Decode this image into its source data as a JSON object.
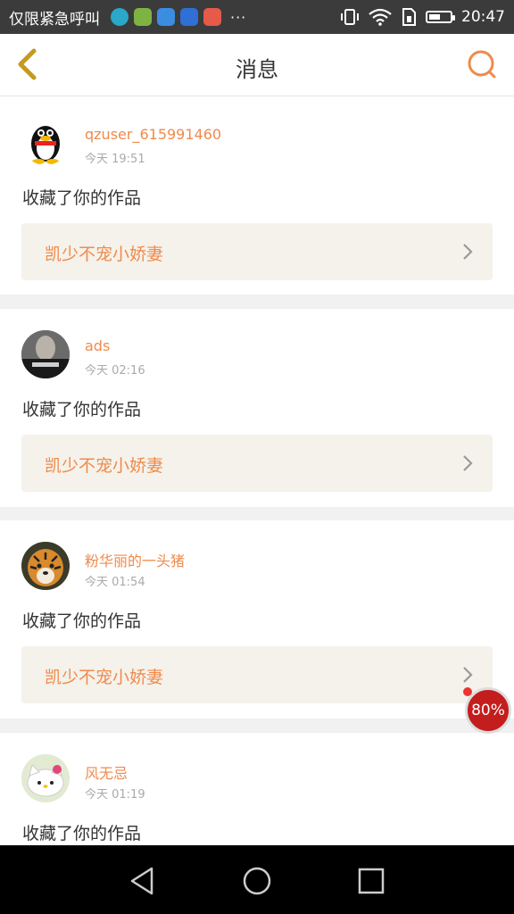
{
  "status_bar": {
    "carrier": "仅限紧急呼叫",
    "dots": "···",
    "time": "20:47",
    "battery_level": 0.55
  },
  "header": {
    "title": "消息"
  },
  "messages": [
    {
      "username": "qzuser_615991460",
      "time": "今天 19:51",
      "action": "收藏了你的作品",
      "work_title": "凯少不宠小娇妻"
    },
    {
      "username": "ads",
      "time": "今天 02:16",
      "action": "收藏了你的作品",
      "work_title": "凯少不宠小娇妻"
    },
    {
      "username": "粉华丽的一头猪",
      "time": "今天 01:54",
      "action": "收藏了你的作品",
      "work_title": "凯少不宠小娇妻"
    },
    {
      "username": "风无忌",
      "time": "今天 01:19",
      "action": "收藏了你的作品"
    }
  ],
  "floating_indicator": {
    "text": "80%"
  },
  "colors": {
    "accent": "#f08a4c",
    "work_bg": "#f4f2ea",
    "status_bg": "#3b3b3b"
  }
}
